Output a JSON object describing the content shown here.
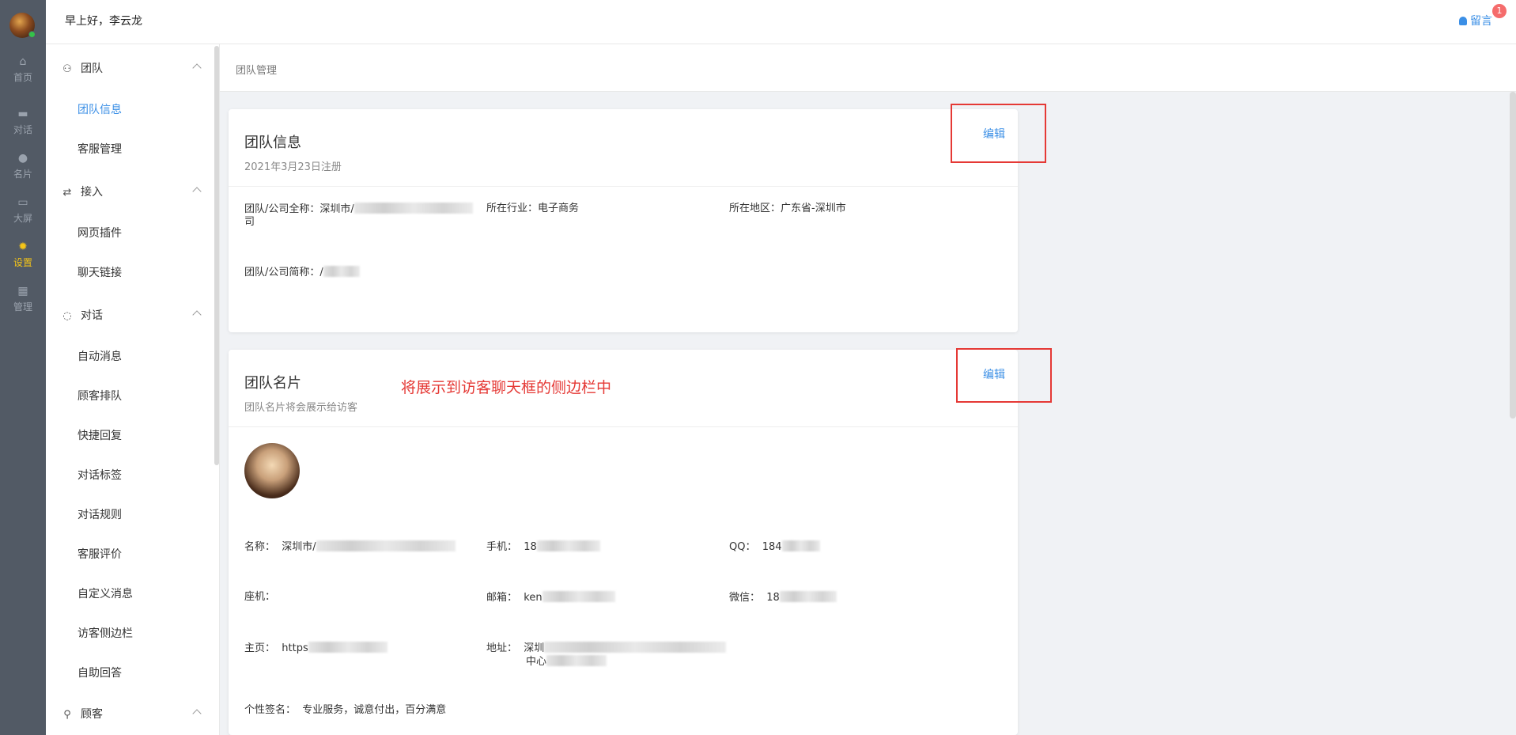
{
  "header": {
    "greeting": "早上好，李云龙",
    "message_label": "留言",
    "message_badge": "1"
  },
  "rail": {
    "items": [
      {
        "label": "首页",
        "icon": "home-icon"
      },
      {
        "label": "对话",
        "icon": "chat-icon"
      },
      {
        "label": "名片",
        "icon": "user-icon"
      },
      {
        "label": "大屏",
        "icon": "screen-icon"
      },
      {
        "label": "设置",
        "icon": "gear-icon",
        "active": true
      },
      {
        "label": "管理",
        "icon": "grid-icon"
      }
    ]
  },
  "menu": {
    "groups": [
      {
        "label": "团队",
        "icon": "team-icon",
        "items": [
          "团队信息",
          "客服管理"
        ]
      },
      {
        "label": "接入",
        "icon": "connect-icon",
        "items": [
          "网页插件",
          "聊天链接"
        ]
      },
      {
        "label": "对话",
        "icon": "dialog-icon",
        "items": [
          "自动消息",
          "顾客排队",
          "快捷回复",
          "对话标签",
          "对话规则",
          "客服评价",
          "自定义消息",
          "访客侧边栏",
          "自助回答"
        ]
      },
      {
        "label": "顾客",
        "icon": "customer-icon",
        "items": []
      }
    ],
    "active_item": "团队信息"
  },
  "breadcrumb": "团队管理",
  "team_info": {
    "title": "团队信息",
    "subtitle": "2021年3月23日注册",
    "edit_label": "编辑",
    "fields": {
      "full_name_label": "团队/公司全称：",
      "full_name_value_start": "深圳市/",
      "full_name_value_end": "司",
      "industry_label": "所在行业：",
      "industry_value": "电子商务",
      "region_label": "所在地区：",
      "region_value": "广东省-深圳市",
      "short_name_label": "团队/公司简称：",
      "short_name_value_start": "/"
    }
  },
  "team_card": {
    "title": "团队名片",
    "subtitle": "团队名片将会展示给访客",
    "edit_label": "编辑",
    "annotation": "将展示到访客聊天框的侧边栏中",
    "fields": {
      "name_label": "名称：",
      "name_value_start": "深圳市/",
      "phone_label": "手机：",
      "phone_value_start": "18",
      "qq_label": "QQ：",
      "qq_value_start": "184",
      "landline_label": "座机：",
      "email_label": "邮箱：",
      "email_value_start": "ken",
      "wechat_label": "微信：",
      "wechat_value_start": "18",
      "homepage_label": "主页：",
      "homepage_value_start": "https",
      "address_label": "地址：",
      "address_value_start": "深圳",
      "address_value_line2": "中心",
      "signature_label": "个性签名：",
      "signature_value": "专业服务，诚意付出，百分满意"
    }
  },
  "colors": {
    "rail_bg": "#525a65",
    "accent": "#3b8fe6",
    "active_rail": "#f5c518",
    "annotation_red": "#e53935",
    "badge_red": "#f56c6c"
  }
}
